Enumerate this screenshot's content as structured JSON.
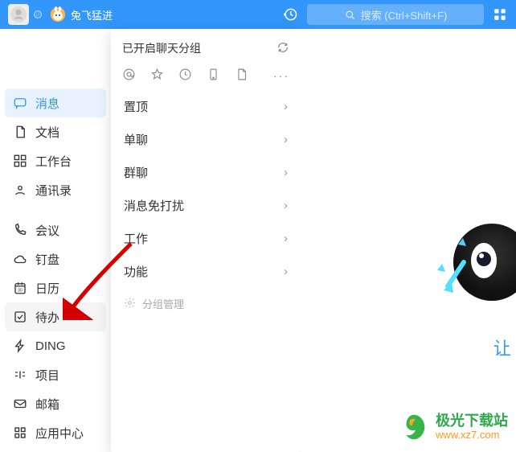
{
  "header": {
    "username": "兔飞猛进",
    "search_placeholder": "搜索 (Ctrl+Shift+F)"
  },
  "sidebar": {
    "items": [
      {
        "label": "消息"
      },
      {
        "label": "文档"
      },
      {
        "label": "工作台"
      },
      {
        "label": "通讯录"
      },
      {
        "label": "会议"
      },
      {
        "label": "钉盘"
      },
      {
        "label": "日历"
      },
      {
        "label": "待办"
      },
      {
        "label": "DING"
      },
      {
        "label": "项目"
      },
      {
        "label": "邮箱"
      },
      {
        "label": "应用中心"
      }
    ]
  },
  "panel": {
    "header": "已开启聊天分组",
    "items": [
      {
        "label": "置顶"
      },
      {
        "label": "单聊"
      },
      {
        "label": "群聊"
      },
      {
        "label": "消息免打扰"
      },
      {
        "label": "工作"
      },
      {
        "label": "功能"
      }
    ],
    "footer": "分组管理"
  },
  "content": {
    "tagline_partial": "让"
  },
  "watermark": {
    "text_zh": "极光下载站",
    "url": "www.xz7.com"
  }
}
